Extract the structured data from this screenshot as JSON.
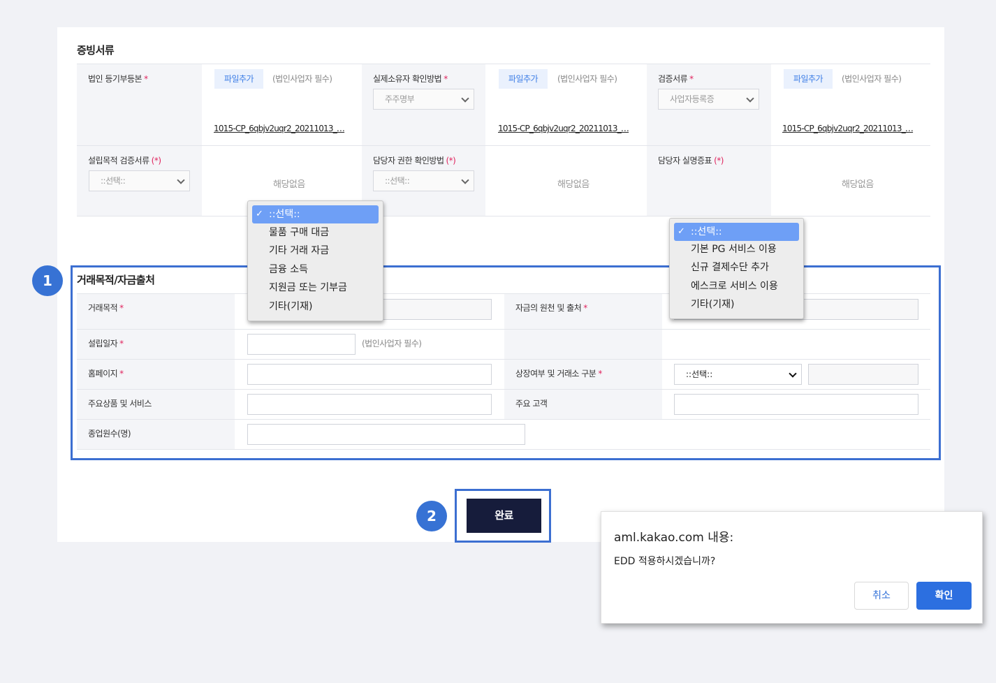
{
  "docs": {
    "title": "증빙서류",
    "row1": {
      "corp_registry_label": "법인 등기부등본",
      "file_add_1": "파일추가",
      "hint_1": "(법인사업자 필수)",
      "file_1": "1015-CP_6qbjv2uqr2_20211013_…",
      "owner_method_label": "실제소유자 확인방법",
      "owner_method_value": "주주명부",
      "file_add_2": "파일추가",
      "hint_2": "(법인사업자 필수)",
      "file_2": "1015-CP_6qbjv2uqr2_20211013_…",
      "verify_doc_label": "검증서류",
      "verify_doc_value": "사업자등록증",
      "file_add_3": "파일추가",
      "hint_3": "(법인사업자 필수)",
      "file_3": "1015-CP_6qbjv2uqr2_20211013_…"
    },
    "row2": {
      "purpose_doc_label": "설립목적 검증서류",
      "purpose_doc_req": "(*)",
      "purpose_doc_value": "::선택::",
      "na_1": "해당없음",
      "auth_method_label": "담당자 권한 확인방법",
      "auth_method_req": "(*)",
      "auth_method_value": "::선택::",
      "na_2": "해당없음",
      "id_proof_label": "담당자 실명증표",
      "id_proof_req": "(*)",
      "na_3": "해당없음"
    }
  },
  "required_mark": "*",
  "form": {
    "title": "거래목적/자금출처",
    "purpose_label": "거래목적",
    "source_label": "자금의 원천 및 출처",
    "founded_label": "설립일자",
    "founded_hint": "(법인사업자 필수)",
    "homepage_label": "홈페이지",
    "listing_label": "상장여부 및 거래소 구분",
    "listing_value": "::선택::",
    "products_label": "주요상품 및 서비스",
    "customers_label": "주요 고객",
    "employees_label": "종업원수(명)"
  },
  "dropdown_purpose": {
    "items": [
      "::선택::",
      "물품 구매 대금",
      "기타 거래 자금",
      "금융 소득",
      "지원금 또는 기부금",
      "기타(기재)"
    ]
  },
  "dropdown_source": {
    "items": [
      "::선택::",
      "기본 PG 서비스 이용",
      "신규 결제수단 추가",
      "에스크로 서비스 이용",
      "기타(기재)"
    ]
  },
  "badges": {
    "one": "1",
    "two": "2"
  },
  "done_button": "완료",
  "dialog": {
    "title": "aml.kakao.com 내용:",
    "message": "EDD 적용하시겠습니까?",
    "cancel": "취소",
    "ok": "확인"
  },
  "colors": {
    "accent": "#3c6fd1",
    "done_button": "#161c3b",
    "confirm": "#2c6fe0",
    "required": "#e0245e"
  }
}
